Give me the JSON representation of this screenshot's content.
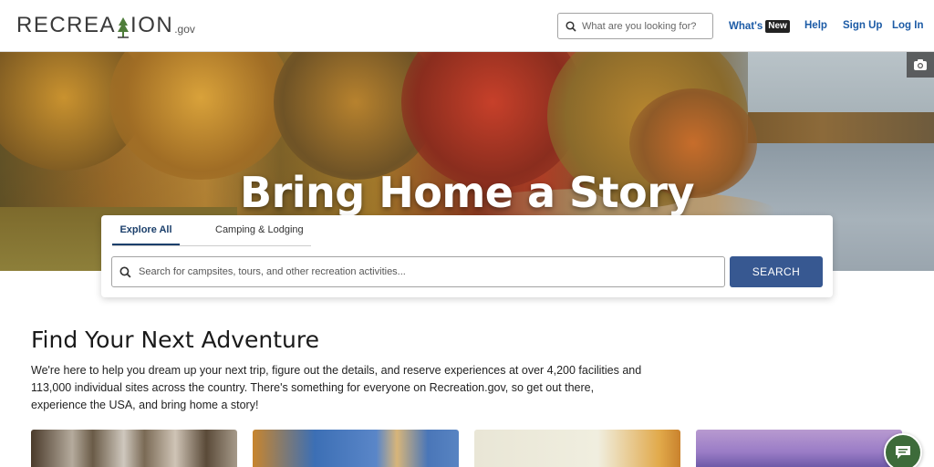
{
  "header": {
    "logo_main_left": "RECREA",
    "logo_main_right": "ION",
    "logo_suffix": ".gov",
    "search_placeholder": "What are you looking for?",
    "nav": {
      "whats_label": "What's",
      "new_badge": "New",
      "help": "Help",
      "sign_up": "Sign Up",
      "log_in": "Log In"
    }
  },
  "hero": {
    "title": "Bring Home a Story"
  },
  "search_card": {
    "tabs": [
      {
        "label": "Explore All",
        "active": true
      },
      {
        "label": "Camping & Lodging",
        "active": false
      }
    ],
    "placeholder": "Search for campsites, tours, and other recreation activities...",
    "button": "SEARCH"
  },
  "intro": {
    "title": "Find Your Next Adventure",
    "text": "We're here to help you dream up your next trip, figure out the details, and reserve experiences at over 4,200 facilities and 113,000 individual sites across the country. There's something for everyone on Recreation.gov, so get out there, experience the USA, and bring home a story!"
  },
  "colors": {
    "brand_blue": "#375891",
    "nav_link": "#1c5ba6",
    "chat_green": "#3d6b3a"
  },
  "icons": {
    "top_search": "search-icon",
    "camera": "camera-icon",
    "main_search": "search-icon",
    "chat": "chat-icon"
  }
}
